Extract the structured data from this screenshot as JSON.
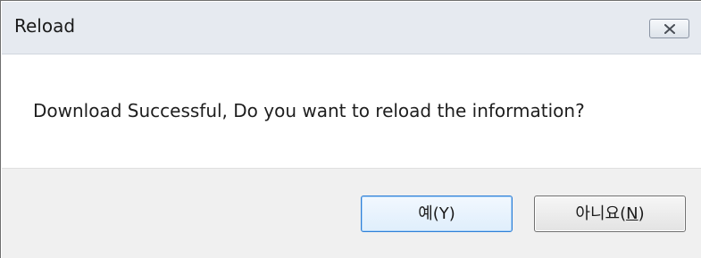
{
  "window": {
    "title": "Reload",
    "close_icon": "close-icon"
  },
  "content": {
    "message": "Download Successful, Do you want to reload the information?"
  },
  "buttons": {
    "yes": {
      "label_prefix": "예(",
      "mnemonic": "Y",
      "label_suffix": ")"
    },
    "no": {
      "label_prefix": "아니요(",
      "mnemonic": "N",
      "label_suffix": ")"
    }
  },
  "colors": {
    "title_bar": "#e6eaf0",
    "footer": "#f0f0f0",
    "default_button_border": "#2f7fd6",
    "button_border": "#707070"
  }
}
